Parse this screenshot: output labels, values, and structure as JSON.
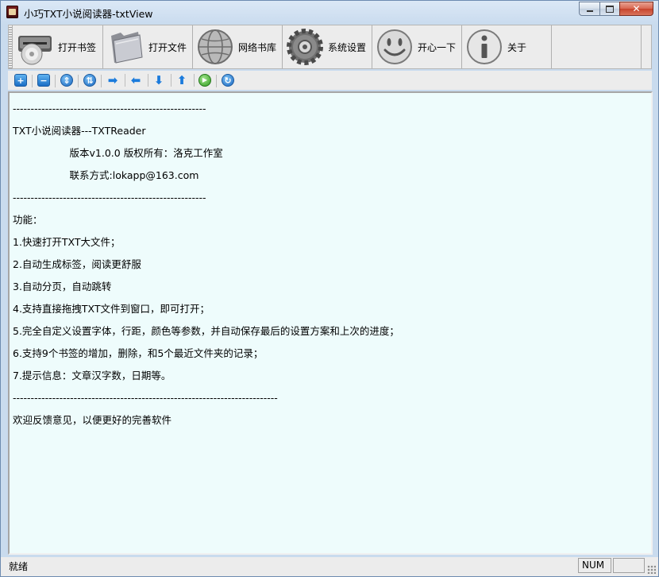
{
  "window": {
    "title": "小巧TXT小说阅读器-txtView"
  },
  "main_toolbar": {
    "items": [
      {
        "label": "打开书签",
        "icon": "cd-drive-icon"
      },
      {
        "label": "打开文件",
        "icon": "folder-icon"
      },
      {
        "label": "网络书库",
        "icon": "globe-icon"
      },
      {
        "label": "系统设置",
        "icon": "gear-icon"
      },
      {
        "label": "开心一下",
        "icon": "smiley-icon"
      },
      {
        "label": "关于",
        "icon": "info-icon"
      }
    ]
  },
  "small_toolbar": {
    "buttons": [
      {
        "icon": "plus-icon",
        "glyph": "+"
      },
      {
        "icon": "minus-icon",
        "glyph": "−"
      },
      {
        "icon": "expand-icon",
        "glyph": "⇕"
      },
      {
        "icon": "collapse-icon",
        "glyph": "⇅"
      },
      {
        "icon": "arrow-right-icon",
        "glyph": "➡"
      },
      {
        "icon": "arrow-left-icon",
        "glyph": "⬅"
      },
      {
        "icon": "arrow-down-icon",
        "glyph": "⬇"
      },
      {
        "icon": "arrow-up-icon",
        "glyph": "⬆"
      },
      {
        "icon": "play-icon",
        "glyph": "▶"
      },
      {
        "icon": "refresh-icon",
        "glyph": "↻"
      }
    ]
  },
  "content": {
    "lines": [
      "------------------------------------------------------",
      "TXT小说阅读器---TXTReader",
      "                  版本v1.0.0 版权所有：洛克工作室",
      "                  联系方式:lokapp@163.com",
      "------------------------------------------------------",
      "功能：",
      "1.快速打开TXT大文件；",
      "2.自动生成标签，阅读更舒服",
      "3.自动分页，自动跳转",
      "4.支持直接拖拽TXT文件到窗口，即可打开；",
      "5.完全自定义设置字体，行距，颜色等参数，并自动保存最后的设置方案和上次的进度；",
      "6.支持9个书签的增加，删除，和5个最近文件夹的记录；",
      "7.提示信息：文章汉字数，日期等。",
      "--------------------------------------------------------------------------",
      "欢迎反馈意见，以便更好的完善软件"
    ]
  },
  "statusbar": {
    "text": "就绪",
    "num": "NUM"
  },
  "colors": {
    "content_background": "#eefcfc",
    "toolbar_background": "#ececec",
    "window_frame": "#c9dbee"
  }
}
